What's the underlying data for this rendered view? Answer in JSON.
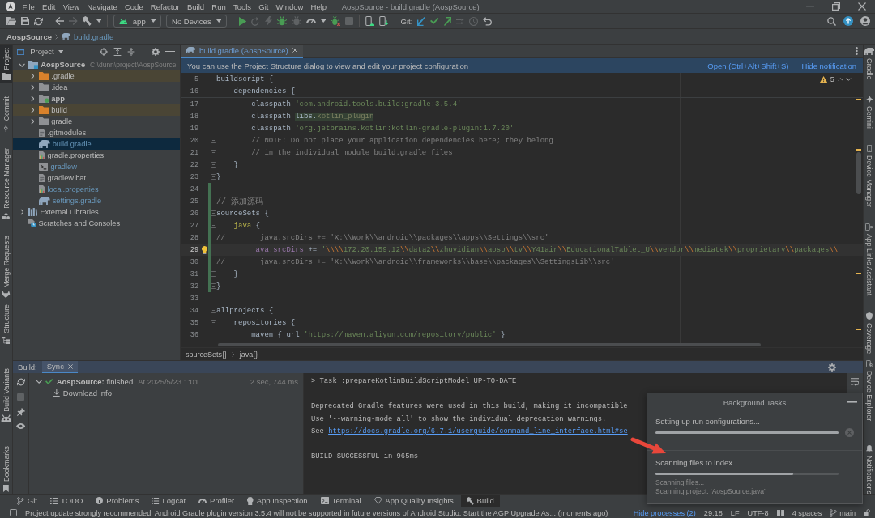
{
  "title_bar": {
    "menu": [
      "File",
      "Edit",
      "View",
      "Navigate",
      "Code",
      "Refactor",
      "Build",
      "Run",
      "Tools",
      "Git",
      "Window",
      "Help"
    ],
    "title": "AospSource - build.gradle (AospSource)"
  },
  "toolbar": {
    "groups": [
      [
        {
          "kind": "open",
          "disabled": false
        },
        {
          "kind": "save",
          "disabled": false
        },
        {
          "kind": "sync",
          "disabled": false
        }
      ],
      [
        {
          "kind": "back",
          "disabled": false
        },
        {
          "kind": "forward",
          "disabled": true
        },
        {
          "kind": "build",
          "disabled": false
        },
        {
          "kind": "caret",
          "disabled": false
        }
      ],
      [
        {
          "kind": "run-config",
          "label": "app",
          "disabled": false
        },
        {
          "kind": "device",
          "label": "No Devices",
          "disabled": false
        }
      ],
      [
        {
          "kind": "run",
          "disabled": false
        },
        {
          "kind": "rerun",
          "disabled": true
        },
        {
          "kind": "apply",
          "disabled": true
        },
        {
          "kind": "debug",
          "disabled": false
        },
        {
          "kind": "attach",
          "disabled": true
        },
        {
          "kind": "profile",
          "disabled": false
        },
        {
          "kind": "caret",
          "disabled": false
        },
        {
          "kind": "attach-debugger",
          "disabled": false
        },
        {
          "kind": "stop",
          "disabled": true
        }
      ],
      [
        {
          "kind": "device-manager",
          "disabled": false
        },
        {
          "kind": "sdk",
          "disabled": false
        }
      ],
      [
        {
          "kind": "git-label",
          "label": "Git:"
        },
        {
          "kind": "git-update",
          "disabled": false
        },
        {
          "kind": "git-commit",
          "disabled": false
        },
        {
          "kind": "git-push",
          "disabled": false
        },
        {
          "kind": "git-fetch",
          "disabled": true
        },
        {
          "kind": "history",
          "disabled": true
        },
        {
          "kind": "rollback",
          "disabled": false
        }
      ]
    ],
    "right": [
      {
        "kind": "search"
      },
      {
        "kind": "update"
      },
      {
        "kind": "account"
      }
    ]
  },
  "navigation_bar": [
    {
      "label": "AospSource",
      "kind": "project"
    },
    {
      "label": "build.gradle",
      "kind": "gradle-file"
    }
  ],
  "left_strip": {
    "top": [
      {
        "label": "Project",
        "kind": "project",
        "selected": true
      },
      {
        "label": "Commit",
        "kind": "commit",
        "selected": false
      },
      {
        "label": "Resource Manager",
        "kind": "resources",
        "selected": false
      },
      {
        "label": "Merge Requests",
        "kind": "merge",
        "selected": false
      }
    ],
    "bottom": [
      {
        "label": "Structure",
        "kind": "structure",
        "selected": false
      },
      {
        "label": "Build Variants",
        "kind": "variants",
        "selected": false
      },
      {
        "label": "Bookmarks",
        "kind": "bookmarks",
        "selected": false
      }
    ]
  },
  "project_panel": {
    "title": "Project",
    "tree": [
      {
        "label": "AospSource",
        "path": "C:\\dunn\\project\\AospSource",
        "kind": "module",
        "expanded": true,
        "selected": false,
        "modified": false,
        "children": [
          {
            "label": ".gradle",
            "kind": "excluded-folder",
            "expanded": false,
            "selected": false,
            "modified": false
          },
          {
            "label": ".idea",
            "kind": "folder",
            "expanded": false,
            "selected": false,
            "modified": false
          },
          {
            "label": "app",
            "kind": "module-folder",
            "expanded": false,
            "selected": false,
            "modified": false
          },
          {
            "label": "build",
            "kind": "excluded-folder",
            "expanded": false,
            "selected": false,
            "modified": false
          },
          {
            "label": "gradle",
            "kind": "folder",
            "expanded": false,
            "selected": false,
            "modified": false
          },
          {
            "label": ".gitmodules",
            "kind": "file-text",
            "selected": false,
            "modified": false
          },
          {
            "label": "build.gradle",
            "kind": "file-gradle",
            "selected": true,
            "modified": true
          },
          {
            "label": "gradle.properties",
            "kind": "file-properties",
            "selected": false,
            "modified": false
          },
          {
            "label": "gradlew",
            "kind": "file-script",
            "selected": false,
            "modified": true
          },
          {
            "label": "gradlew.bat",
            "kind": "file-text",
            "selected": false,
            "modified": false
          },
          {
            "label": "local.properties",
            "kind": "file-properties",
            "selected": false,
            "modified": true
          },
          {
            "label": "settings.gradle",
            "kind": "file-gradle",
            "selected": false,
            "modified": true
          }
        ]
      },
      {
        "label": "External Libraries",
        "kind": "libraries",
        "expanded": false,
        "selected": false,
        "modified": false
      },
      {
        "label": "Scratches and Consoles",
        "kind": "scratches",
        "selected": false,
        "modified": false
      }
    ]
  },
  "editor": {
    "tabs": [
      {
        "label": "build.gradle (AospSource)",
        "selected": true
      }
    ],
    "notification": {
      "text": "You can use the Project Structure dialog to view and edit your project configuration",
      "actions": [
        "Open (Ctrl+Alt+Shift+S)",
        "Hide notification"
      ]
    },
    "warnings": "5",
    "sticky_lines": [
      {
        "number": "5",
        "segments": [
          {
            "text": "buildscript {",
            "kind": "plain"
          }
        ]
      },
      {
        "number": "16",
        "segments": [
          {
            "text": "    dependencies {",
            "kind": "plain"
          }
        ]
      }
    ],
    "lines": [
      {
        "number": "17",
        "current": false,
        "fold": false,
        "changed": false,
        "segments": [
          {
            "text": "        classpath ",
            "kind": "plain"
          },
          {
            "text": "'com.android.tools.build:gradle:3.5.4'",
            "kind": "string"
          }
        ]
      },
      {
        "number": "18",
        "current": false,
        "fold": false,
        "changed": false,
        "segments": [
          {
            "text": "        classpath ",
            "kind": "plain"
          },
          {
            "text": "libs.",
            "kind": "usage"
          },
          {
            "text": "kotlin_plugin",
            "kind": "usage-dim"
          }
        ]
      },
      {
        "number": "19",
        "current": false,
        "fold": false,
        "changed": false,
        "segments": [
          {
            "text": "        classpath ",
            "kind": "plain"
          },
          {
            "text": "'org.jetbrains.kotlin:kotlin-gradle-plugin:1.7.20'",
            "kind": "string"
          }
        ]
      },
      {
        "number": "20",
        "current": false,
        "fold": true,
        "changed": false,
        "segments": [
          {
            "text": "        // NOTE: Do not place your application dependencies here; they belong",
            "kind": "comment"
          }
        ]
      },
      {
        "number": "21",
        "current": false,
        "fold": true,
        "changed": false,
        "segments": [
          {
            "text": "        // in the individual module build.gradle files",
            "kind": "comment"
          }
        ]
      },
      {
        "number": "22",
        "current": false,
        "fold": true,
        "changed": false,
        "segments": [
          {
            "text": "    }",
            "kind": "plain"
          }
        ]
      },
      {
        "number": "23",
        "current": false,
        "fold": true,
        "changed": false,
        "segments": [
          {
            "text": "}",
            "kind": "plain"
          }
        ]
      },
      {
        "number": "24",
        "current": false,
        "fold": false,
        "changed": true
      },
      {
        "number": "25",
        "current": false,
        "fold": false,
        "changed": true,
        "segments": [
          {
            "text": "// 添加源码",
            "kind": "comment"
          }
        ]
      },
      {
        "number": "26",
        "current": false,
        "fold": true,
        "changed": true,
        "segments": [
          {
            "text": "sourceSets {",
            "kind": "plain"
          }
        ]
      },
      {
        "number": "27",
        "current": false,
        "fold": true,
        "changed": true,
        "segments": [
          {
            "text": "    java",
            "kind": "method"
          },
          {
            "text": " {",
            "kind": "plain"
          }
        ]
      },
      {
        "number": "28",
        "current": false,
        "fold": false,
        "changed": true,
        "segments": [
          {
            "text": "//        java.srcDirs += 'X:\\\\Work\\\\android\\\\packages\\\\apps\\\\Settings\\\\src'",
            "kind": "comment"
          }
        ]
      },
      {
        "number": "29",
        "current": true,
        "fold": false,
        "changed": true,
        "segments": [
          {
            "text": "        java.srcDirs",
            "kind": "field"
          },
          {
            "text": " += ",
            "kind": "plain"
          },
          {
            "text": "'",
            "kind": "string"
          },
          {
            "text": "\\\\\\\\",
            "kind": "escape"
          },
          {
            "text": "172.20.159.12",
            "kind": "string"
          },
          {
            "text": "\\\\",
            "kind": "escape"
          },
          {
            "text": "data2",
            "kind": "string"
          },
          {
            "text": "\\\\",
            "kind": "escape"
          },
          {
            "text": "zhuyidian",
            "kind": "string"
          },
          {
            "text": "\\\\",
            "kind": "escape"
          },
          {
            "text": "aosp",
            "kind": "string"
          },
          {
            "text": "\\\\",
            "kind": "escape"
          },
          {
            "text": "tv",
            "kind": "string"
          },
          {
            "text": "\\\\",
            "kind": "escape"
          },
          {
            "text": "Y41air",
            "kind": "string"
          },
          {
            "text": "\\\\",
            "kind": "escape"
          },
          {
            "text": "EducationalTablet_U",
            "kind": "string"
          },
          {
            "text": "\\\\",
            "kind": "escape"
          },
          {
            "text": "vendor",
            "kind": "string"
          },
          {
            "text": "\\\\",
            "kind": "escape"
          },
          {
            "text": "mediatek",
            "kind": "string"
          },
          {
            "text": "\\\\",
            "kind": "escape"
          },
          {
            "text": "proprietary",
            "kind": "string"
          },
          {
            "text": "\\\\",
            "kind": "escape"
          },
          {
            "text": "packages",
            "kind": "string"
          },
          {
            "text": "\\\\",
            "kind": "escape"
          }
        ]
      },
      {
        "number": "30",
        "current": false,
        "fold": false,
        "changed": true,
        "segments": [
          {
            "text": "//        java.srcDirs += 'X:\\\\Work\\\\android\\\\frameworks\\\\base\\\\packages\\\\SettingsLib\\\\src'",
            "kind": "comment"
          }
        ]
      },
      {
        "number": "31",
        "current": false,
        "fold": true,
        "changed": true,
        "segments": [
          {
            "text": "    }",
            "kind": "plain"
          }
        ]
      },
      {
        "number": "32",
        "current": false,
        "fold": true,
        "changed": true,
        "segments": [
          {
            "text": "}",
            "kind": "plain"
          }
        ]
      },
      {
        "number": "33",
        "current": false,
        "fold": false,
        "changed": false
      },
      {
        "number": "34",
        "current": false,
        "fold": true,
        "changed": false,
        "segments": [
          {
            "text": "allprojects {",
            "kind": "plain"
          }
        ]
      },
      {
        "number": "35",
        "current": false,
        "fold": true,
        "changed": false,
        "segments": [
          {
            "text": "    repositories {",
            "kind": "plain"
          }
        ]
      },
      {
        "number": "36",
        "current": false,
        "fold": false,
        "changed": false,
        "segments": [
          {
            "text": "        maven { url ",
            "kind": "plain"
          },
          {
            "text": "'",
            "kind": "string"
          },
          {
            "text": "https://maven.aliyun.com/repository/public",
            "kind": "link"
          },
          {
            "text": "'",
            "kind": "string"
          },
          {
            "text": " }",
            "kind": "plain"
          }
        ]
      }
    ],
    "breadcrumbs": [
      "sourceSets{}",
      "java{}"
    ]
  },
  "right_strip": {
    "top": [
      {
        "label": "Gradle",
        "kind": "gradle"
      },
      {
        "label": "Gemini",
        "kind": "gemini"
      },
      {
        "label": "Device Manager",
        "kind": "devices"
      },
      {
        "label": "App Links Assistant",
        "kind": "links"
      },
      {
        "label": "Coverage",
        "kind": "coverage"
      }
    ],
    "bottom": [
      {
        "label": "Device Explorer",
        "kind": "explorer"
      },
      {
        "label": "Notifications",
        "kind": "notifications"
      }
    ]
  },
  "build_panel": {
    "label": "Build:",
    "tabs": [
      {
        "label": "Sync",
        "selected": true
      }
    ],
    "tree": [
      {
        "title": "**AospSource:** finished",
        "success": true,
        "time": "At 2025/5/23 1:01",
        "duration": "2 sec, 744 ms",
        "expanded": true,
        "children": [
          {
            "title": "Download info",
            "kind": "download"
          }
        ]
      }
    ],
    "console": [
      {
        "lines": [
          {
            "segments": [
              {
                "text": "> Task :prepareKotlinBuildScriptModel UP-TO-DATE",
                "kind": "plain"
              }
            ]
          }
        ]
      },
      {
        "lines": [
          {
            "segments": [
              {
                "text": "Deprecated Gradle features were used in this build, making it incompatible",
                "kind": "plain"
              }
            ]
          },
          {
            "segments": [
              {
                "text": "Use '--warning-mode all' to show the individual deprecation warnings.",
                "kind": "plain"
              }
            ]
          },
          {
            "segments": [
              {
                "text": "See ",
                "kind": "plain"
              },
              {
                "text": "https://docs.gradle.org/6.7.1/userguide/command_line_interface.html#se",
                "kind": "link"
              }
            ]
          }
        ]
      },
      {
        "lines": [
          {
            "segments": [
              {
                "text": "BUILD SUCCESSFUL in 965ms",
                "kind": "plain"
              }
            ]
          }
        ]
      }
    ]
  },
  "background_tasks": {
    "title": "Background Tasks",
    "tasks": [
      {
        "label": "Setting up run configurations...",
        "level": 1,
        "cancellable": true
      },
      {
        "label": "Scanning files to index...",
        "level": 0.75,
        "cancellable": false,
        "details": [
          "Scanning files...",
          "Scanning project: 'AospSource.java'"
        ]
      }
    ]
  },
  "annotation": {
    "kind": "arrow"
  },
  "tool_windows": [
    {
      "label": "Git",
      "kind": "git",
      "selected": false
    },
    {
      "label": "TODO",
      "kind": "todo",
      "selected": false
    },
    {
      "label": "Problems",
      "kind": "problems",
      "selected": false
    },
    {
      "label": "Logcat",
      "kind": "logcat",
      "selected": false
    },
    {
      "label": "Profiler",
      "kind": "profiler",
      "selected": false
    },
    {
      "label": "App Inspection",
      "kind": "inspection",
      "selected": false
    },
    {
      "label": "Terminal",
      "kind": "terminal",
      "selected": false
    },
    {
      "label": "App Quality Insights",
      "kind": "insights",
      "selected": false
    },
    {
      "label": "Build",
      "kind": "build",
      "selected": true
    }
  ],
  "status_bar": {
    "message": "Project update strongly recommended: Android Gradle plugin version 3.5.4 will not be supported in future versions of Android Studio. Start the AGP Upgrade As... (moments ago)",
    "processes": "Hide processes (2)",
    "position": "29:18",
    "line_separator": "LF",
    "encoding": "UTF-8",
    "indent": "4 spaces",
    "branch": "main"
  }
}
